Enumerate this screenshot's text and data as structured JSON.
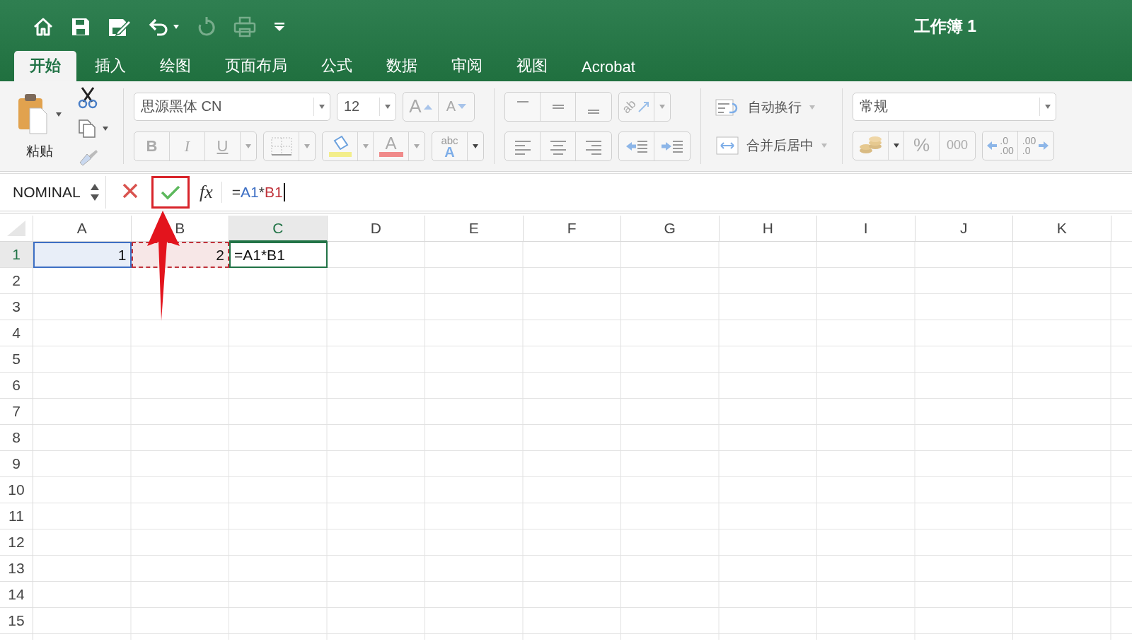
{
  "window": {
    "title": "工作簿 1"
  },
  "quick_access": [
    {
      "kind": "home",
      "disabled": false
    },
    {
      "kind": "save",
      "disabled": false
    },
    {
      "kind": "edit",
      "disabled": false
    },
    {
      "kind": "undo",
      "disabled": false
    },
    {
      "kind": "redo",
      "disabled": true
    },
    {
      "kind": "print",
      "disabled": true
    },
    {
      "kind": "customize",
      "disabled": false
    }
  ],
  "tabs": [
    {
      "label": "开始",
      "selected": true
    },
    {
      "label": "插入",
      "selected": false
    },
    {
      "label": "绘图",
      "selected": false
    },
    {
      "label": "页面布局",
      "selected": false
    },
    {
      "label": "公式",
      "selected": false
    },
    {
      "label": "数据",
      "selected": false
    },
    {
      "label": "审阅",
      "selected": false
    },
    {
      "label": "视图",
      "selected": false
    },
    {
      "label": "Acrobat",
      "selected": false
    }
  ],
  "ribbon": {
    "paste_label": "粘贴",
    "font_name": "思源黑体 CN",
    "font_size": "12",
    "grow_font": "A",
    "shrink_font": "A",
    "bold": "B",
    "italic": "I",
    "underline": "U",
    "font_color": "A",
    "phonetic_top": "abc",
    "phonetic_bottom": "A",
    "orientation": "ab",
    "wrap_text": "自动换行",
    "merge_center": "合并后居中",
    "number_format": "常规",
    "percent": "%",
    "thousands": "000",
    "increase_decimal": {
      "top": ".0",
      "bottom": ".00"
    },
    "decrease_decimal": {
      "top": ".00",
      "bottom": ".0"
    }
  },
  "formula_bar": {
    "name_box": "NOMINAL",
    "fx": "fx",
    "confirm_highlighted": true,
    "formula": [
      {
        "text": "=",
        "color": "#333333"
      },
      {
        "text": "A1",
        "color": "#3d6fc4"
      },
      {
        "text": "*",
        "color": "#333333"
      },
      {
        "text": "B1",
        "color": "#c0333b"
      }
    ]
  },
  "sheet": {
    "columns": [
      {
        "label": "A",
        "selected": false
      },
      {
        "label": "B",
        "selected": false
      },
      {
        "label": "C",
        "selected": true
      },
      {
        "label": "D",
        "selected": false
      },
      {
        "label": "E",
        "selected": false
      },
      {
        "label": "F",
        "selected": false
      },
      {
        "label": "G",
        "selected": false
      },
      {
        "label": "H",
        "selected": false
      },
      {
        "label": "I",
        "selected": false
      },
      {
        "label": "J",
        "selected": false
      },
      {
        "label": "K",
        "selected": false
      }
    ],
    "rows": [
      {
        "label": "1",
        "selected": true,
        "cells": [
          {
            "text": "1",
            "kind": "ref",
            "color": "#3d6fc4",
            "dashed": false
          },
          {
            "text": "2",
            "kind": "ref",
            "color": "#c0333b",
            "dashed": true
          },
          {
            "text": "=A1*B1",
            "kind": "active"
          }
        ]
      },
      {
        "label": "2",
        "selected": false
      },
      {
        "label": "3",
        "selected": false
      },
      {
        "label": "4",
        "selected": false
      },
      {
        "label": "5",
        "selected": false
      },
      {
        "label": "6",
        "selected": false
      },
      {
        "label": "7",
        "selected": false
      },
      {
        "label": "8",
        "selected": false
      },
      {
        "label": "9",
        "selected": false
      },
      {
        "label": "10",
        "selected": false
      },
      {
        "label": "11",
        "selected": false
      },
      {
        "label": "12",
        "selected": false
      },
      {
        "label": "13",
        "selected": false
      },
      {
        "label": "14",
        "selected": false
      },
      {
        "label": "15",
        "selected": false
      }
    ]
  }
}
